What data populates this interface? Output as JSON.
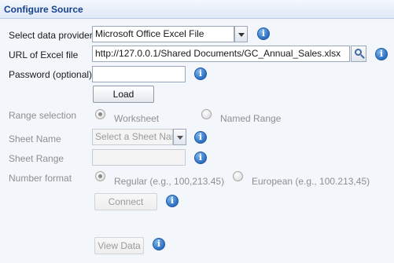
{
  "panel": {
    "title": "Configure Source"
  },
  "fields": {
    "data_provider": {
      "label": "Select data provider",
      "value": "Microsoft Office Excel File"
    },
    "url": {
      "label": "URL of Excel file",
      "value": "http://127.0.0.1/Shared Documents/GC_Annual_Sales.xlsx"
    },
    "password": {
      "label": "Password (optional)",
      "value": ""
    },
    "load_button": "Load",
    "range_selection": {
      "label": "Range selection",
      "option_worksheet": "Worksheet",
      "option_named_range": "Named Range",
      "selected": "Worksheet"
    },
    "sheet_name": {
      "label": "Sheet Name",
      "placeholder": "Select a Sheet Name"
    },
    "sheet_range": {
      "label": "Sheet Range",
      "value": ""
    },
    "number_format": {
      "label": "Number format",
      "option_regular": "Regular (e.g., 100,213.45)",
      "option_european": "European (e.g., 100.213,45)",
      "selected": "Regular (e.g., 100,213.45)"
    },
    "connect_button": "Connect",
    "view_data_button": "View Data"
  },
  "colors": {
    "header_text": "#15428b",
    "disabled_text": "#8f8f8f",
    "info_icon": "#2c6fc2"
  }
}
